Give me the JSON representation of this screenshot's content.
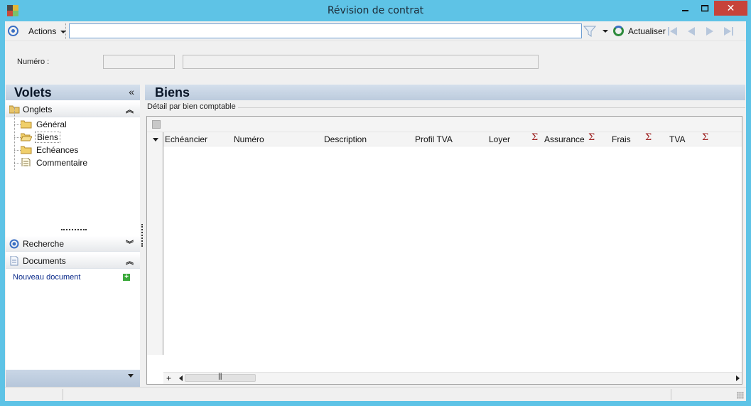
{
  "window": {
    "title": "Révision de contrat",
    "close_glyph": "✕"
  },
  "toolbar": {
    "actions_label": "Actions",
    "search_value": "",
    "refresh_label": "Actualiser"
  },
  "header_form": {
    "numero_label": "Numéro :",
    "numero_value": "",
    "description_value": ""
  },
  "left_panel": {
    "title": "Volets",
    "collapse_glyph": "«",
    "onglets": {
      "label": "Onglets",
      "chevron": "︽",
      "items": [
        {
          "label": "Général",
          "selected": false
        },
        {
          "label": "Biens",
          "selected": true
        },
        {
          "label": "Echéances",
          "selected": false
        },
        {
          "label": "Commentaire",
          "selected": false
        }
      ]
    },
    "recherche": {
      "label": "Recherche",
      "chevron": "︾"
    },
    "documents": {
      "label": "Documents",
      "chevron": "︽",
      "new_doc_label": "Nouveau document",
      "add_glyph": "+"
    }
  },
  "main": {
    "title": "Biens",
    "group_label": "Détail par bien comptable",
    "columns": [
      {
        "label": "Echéancier",
        "sum": false
      },
      {
        "label": "Numéro",
        "sum": false
      },
      {
        "label": "Description",
        "sum": false
      },
      {
        "label": "Profil TVA",
        "sum": false
      },
      {
        "label": "Loyer",
        "sum": true
      },
      {
        "label": "Assurance",
        "sum": true
      },
      {
        "label": "Frais",
        "sum": true
      },
      {
        "label": "TVA",
        "sum": true
      }
    ],
    "sigma_glyph": "Σ",
    "plus_glyph": "+",
    "thumb_glyph": "|||",
    "rows": []
  },
  "status": {
    "cells": [
      "",
      ""
    ]
  },
  "colors": {
    "accent": "#5ec3e6",
    "close": "#c7433a",
    "panel_header": "#c5d3e3"
  }
}
